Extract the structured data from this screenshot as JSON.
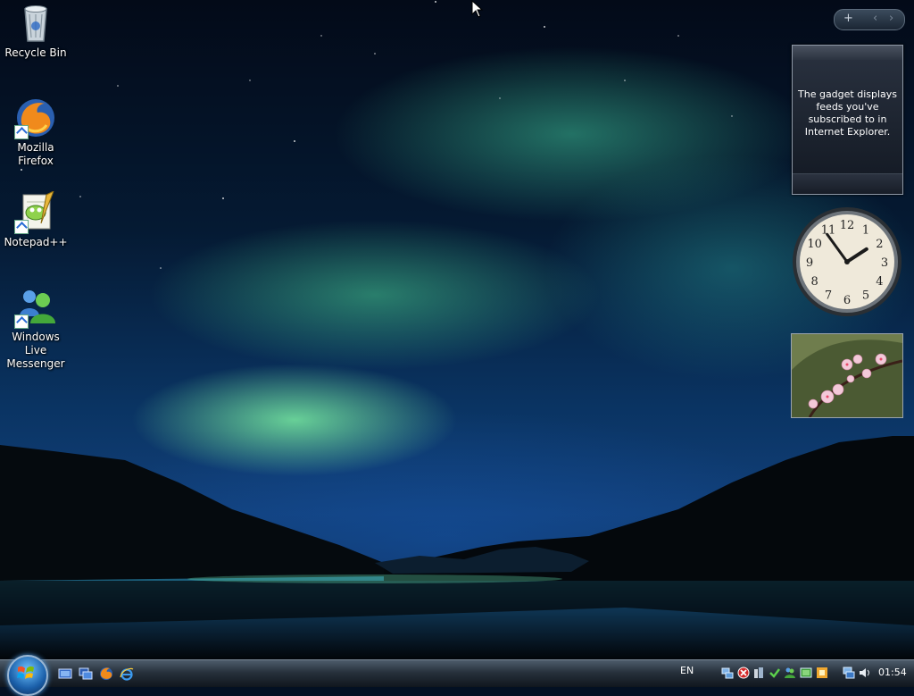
{
  "desktop": {
    "icons": [
      {
        "label": "Recycle Bin",
        "icon": "recycle-bin-icon"
      },
      {
        "label": "Mozilla Firefox",
        "icon": "firefox-icon"
      },
      {
        "label": "Notepad++",
        "icon": "notepad-plus-plus-icon"
      },
      {
        "label": "Windows Live Messenger",
        "icon": "windows-live-messenger-icon"
      }
    ]
  },
  "sidebar": {
    "controls": {
      "add": "+",
      "prev": "‹",
      "next": "›"
    },
    "feed_gadget": {
      "message": "The gadget displays feeds you've subscribed to in Internet Explorer."
    },
    "clock_gadget": {
      "numerals": [
        "12",
        "1",
        "2",
        "3",
        "4",
        "5",
        "6",
        "7",
        "8",
        "9",
        "10",
        "11"
      ],
      "time": "01:54"
    },
    "slideshow_gadget": {
      "subject": "pink-flowers-photo"
    }
  },
  "taskbar": {
    "start_icon": "windows-start-orb",
    "quick_launch": [
      "show-desktop-icon",
      "switch-windows-icon",
      "firefox-icon",
      "internet-explorer-icon"
    ],
    "language": "EN",
    "tray_icons": [
      "network-icon",
      "security-alert-icon",
      "windows-defender-icon",
      "update-icon",
      "messenger-icon",
      "battery-icon",
      "antivirus-icon",
      "network-connection-icon",
      "volume-icon"
    ],
    "clock": "01:54"
  },
  "colors": {
    "taskbar": "#27313c",
    "aurora": "#78eba0",
    "sky": "#0a3463"
  }
}
